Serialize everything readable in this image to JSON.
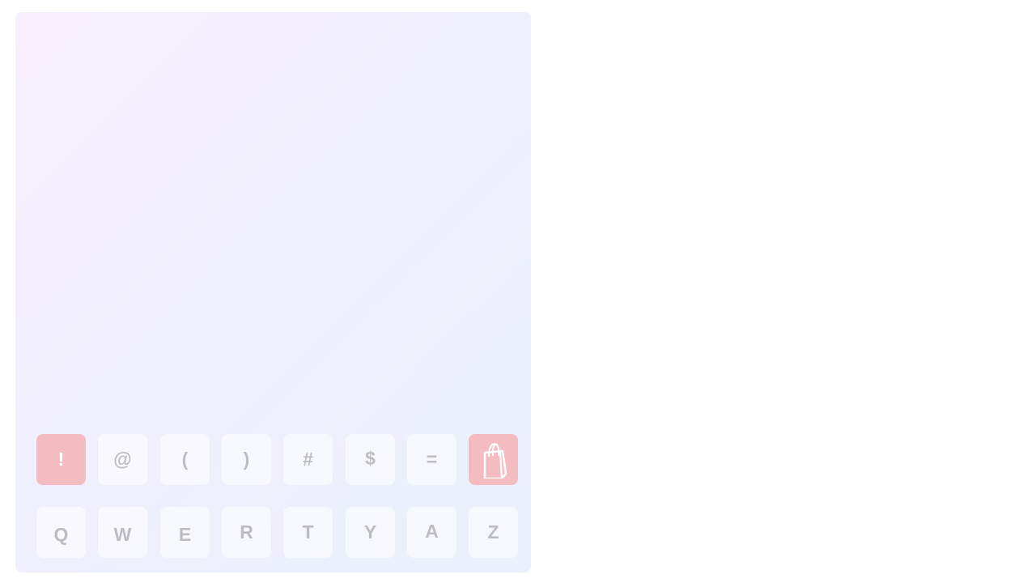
{
  "keyboard": {
    "symbol_row": [
      "!",
      "@",
      "(",
      ")",
      "#",
      "$",
      "="
    ],
    "letter_row": [
      "Q",
      "W",
      "E",
      "R",
      "T",
      "Y",
      "A",
      "Z"
    ],
    "bag_key_icon": "shopping-bag-icon"
  },
  "colors": {
    "panel_gradient_start": "#f8efff",
    "panel_gradient_end": "#eaf0fc",
    "key_background": "#f6f5fc",
    "accent_key_background": "#f4bcc0",
    "key_glyph": "#bdbcc3"
  }
}
